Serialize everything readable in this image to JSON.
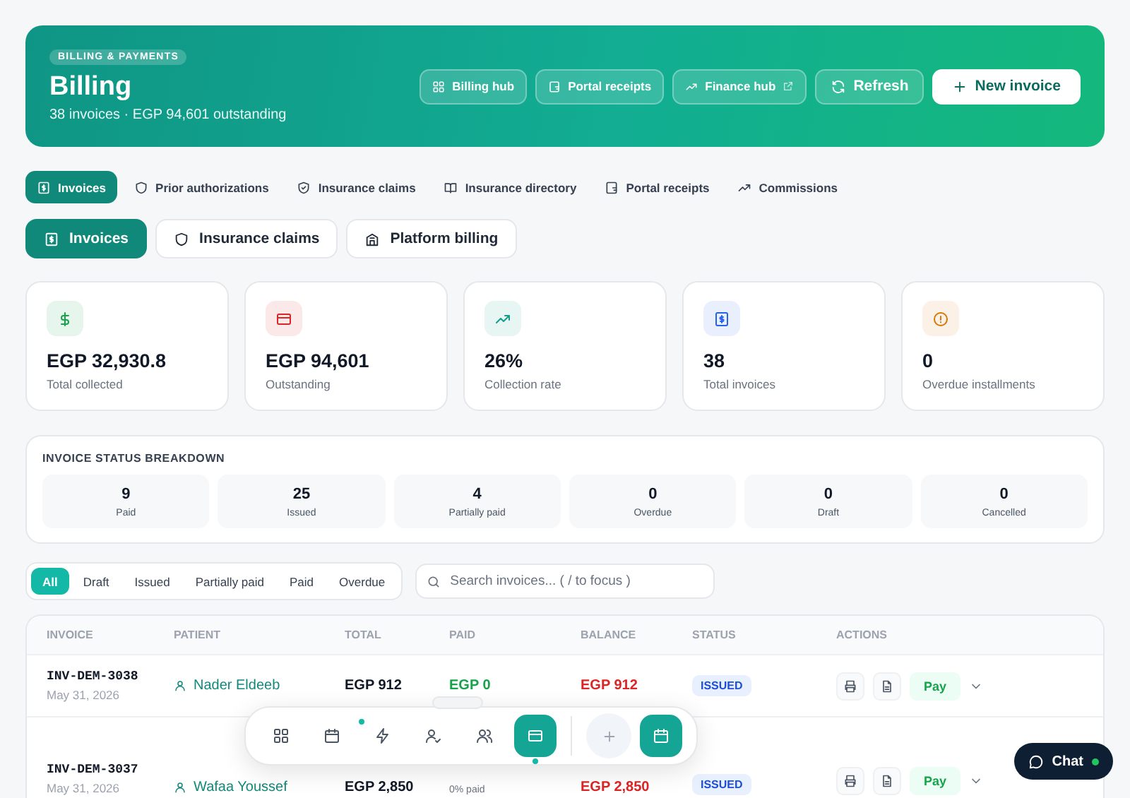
{
  "header": {
    "eyebrow": "BILLING & PAYMENTS",
    "title": "Billing",
    "subtitle": "38 invoices · EGP 94,601 outstanding",
    "buttons": [
      {
        "label": "Billing hub",
        "kind": "ghost"
      },
      {
        "label": "Portal receipts",
        "kind": "ghost"
      },
      {
        "label": "Finance hub",
        "kind": "external"
      },
      {
        "label": "Refresh",
        "kind": "ghost"
      },
      {
        "label": "New invoice",
        "kind": "primary"
      }
    ]
  },
  "nav_tabs": [
    {
      "label": "Invoices",
      "selected": true
    },
    {
      "label": "Prior authorizations",
      "selected": false
    },
    {
      "label": "Insurance claims",
      "selected": false
    },
    {
      "label": "Insurance directory",
      "selected": false
    },
    {
      "label": "Portal receipts",
      "selected": false
    },
    {
      "label": "Commissions",
      "selected": false
    }
  ],
  "sub_tabs": [
    {
      "label": "Invoices",
      "selected": true
    },
    {
      "label": "Insurance claims",
      "selected": false
    },
    {
      "label": "Platform billing",
      "selected": false
    }
  ],
  "stats": [
    {
      "value": "EGP 32,930.8",
      "label": "Total collected",
      "color": "#16a34a"
    },
    {
      "value": "EGP 94,601",
      "label": "Outstanding",
      "color": "#dc2626"
    },
    {
      "value": "26%",
      "label": "Collection rate",
      "color": "#0f9f8a"
    },
    {
      "value": "38",
      "label": "Total invoices",
      "color": "#2563eb"
    },
    {
      "value": "0",
      "label": "Overdue installments",
      "color": "#d97706"
    }
  ],
  "breakdown": {
    "title": "INVOICE STATUS BREAKDOWN",
    "items": [
      {
        "count": "9",
        "label": "Paid"
      },
      {
        "count": "25",
        "label": "Issued"
      },
      {
        "count": "4",
        "label": "Partially paid"
      },
      {
        "count": "0",
        "label": "Overdue"
      },
      {
        "count": "0",
        "label": "Draft"
      },
      {
        "count": "0",
        "label": "Cancelled"
      }
    ]
  },
  "filters": [
    {
      "label": "All",
      "selected": true
    },
    {
      "label": "Draft",
      "selected": false
    },
    {
      "label": "Issued",
      "selected": false
    },
    {
      "label": "Partially paid",
      "selected": false
    },
    {
      "label": "Paid",
      "selected": false
    },
    {
      "label": "Overdue",
      "selected": false
    }
  ],
  "search": {
    "placeholder": "Search invoices... ( / to focus )"
  },
  "table": {
    "columns": [
      "INVOICE",
      "PATIENT",
      "TOTAL",
      "PAID",
      "BALANCE",
      "STATUS",
      "ACTIONS"
    ],
    "rows": [
      {
        "invoice": "INV-DEM-3038",
        "date": "May 31, 2026",
        "patient": "Nader Eldeeb",
        "total": "EGP 912",
        "paid": "EGP 0",
        "balance": "EGP 912",
        "status": "ISSUED",
        "action": "Pay"
      },
      {
        "invoice": "INV-DEM-3037",
        "date": "May 31, 2026",
        "patient": "Wafaa Youssef",
        "total": "EGP 2,850",
        "paid_note": "0% paid",
        "balance": "EGP 2,850",
        "status": "ISSUED",
        "action": "Pay"
      }
    ]
  },
  "dock": {
    "items": [
      {
        "selected": false
      },
      {
        "selected": false
      },
      {
        "selected": false
      },
      {
        "selected": false
      },
      {
        "selected": false
      },
      {
        "selected": true
      }
    ]
  },
  "chat": {
    "label": "Chat",
    "online": true
  }
}
